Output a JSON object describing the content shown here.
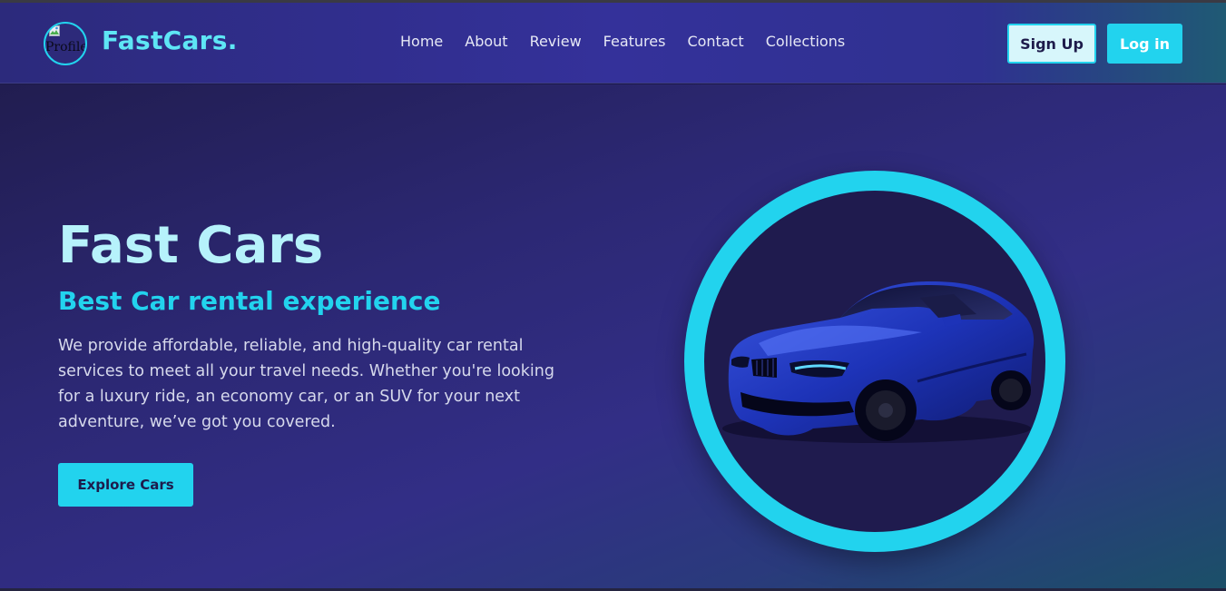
{
  "header": {
    "logo_alt": "Profile",
    "brand": "FastCars.",
    "nav": [
      "Home",
      "About",
      "Review",
      "Features",
      "Contact",
      "Collections"
    ],
    "signup_label": "Sign Up",
    "login_label": "Log in"
  },
  "hero": {
    "title": "Fast Cars",
    "subtitle": "Best Car rental experience",
    "description": "We provide affordable, reliable, and high-quality car rental services to meet all your travel needs. Whether you're looking for a luxury ride, an economy car, or an SUV for your next adventure, we’ve got you covered.",
    "cta_label": "Explore Cars"
  },
  "colors": {
    "accent": "#22d3ee",
    "title": "#b6f2fb",
    "background": "#2c2874"
  },
  "icons": {
    "logo": "broken-image-icon",
    "hero_image": "blue-sports-car"
  }
}
